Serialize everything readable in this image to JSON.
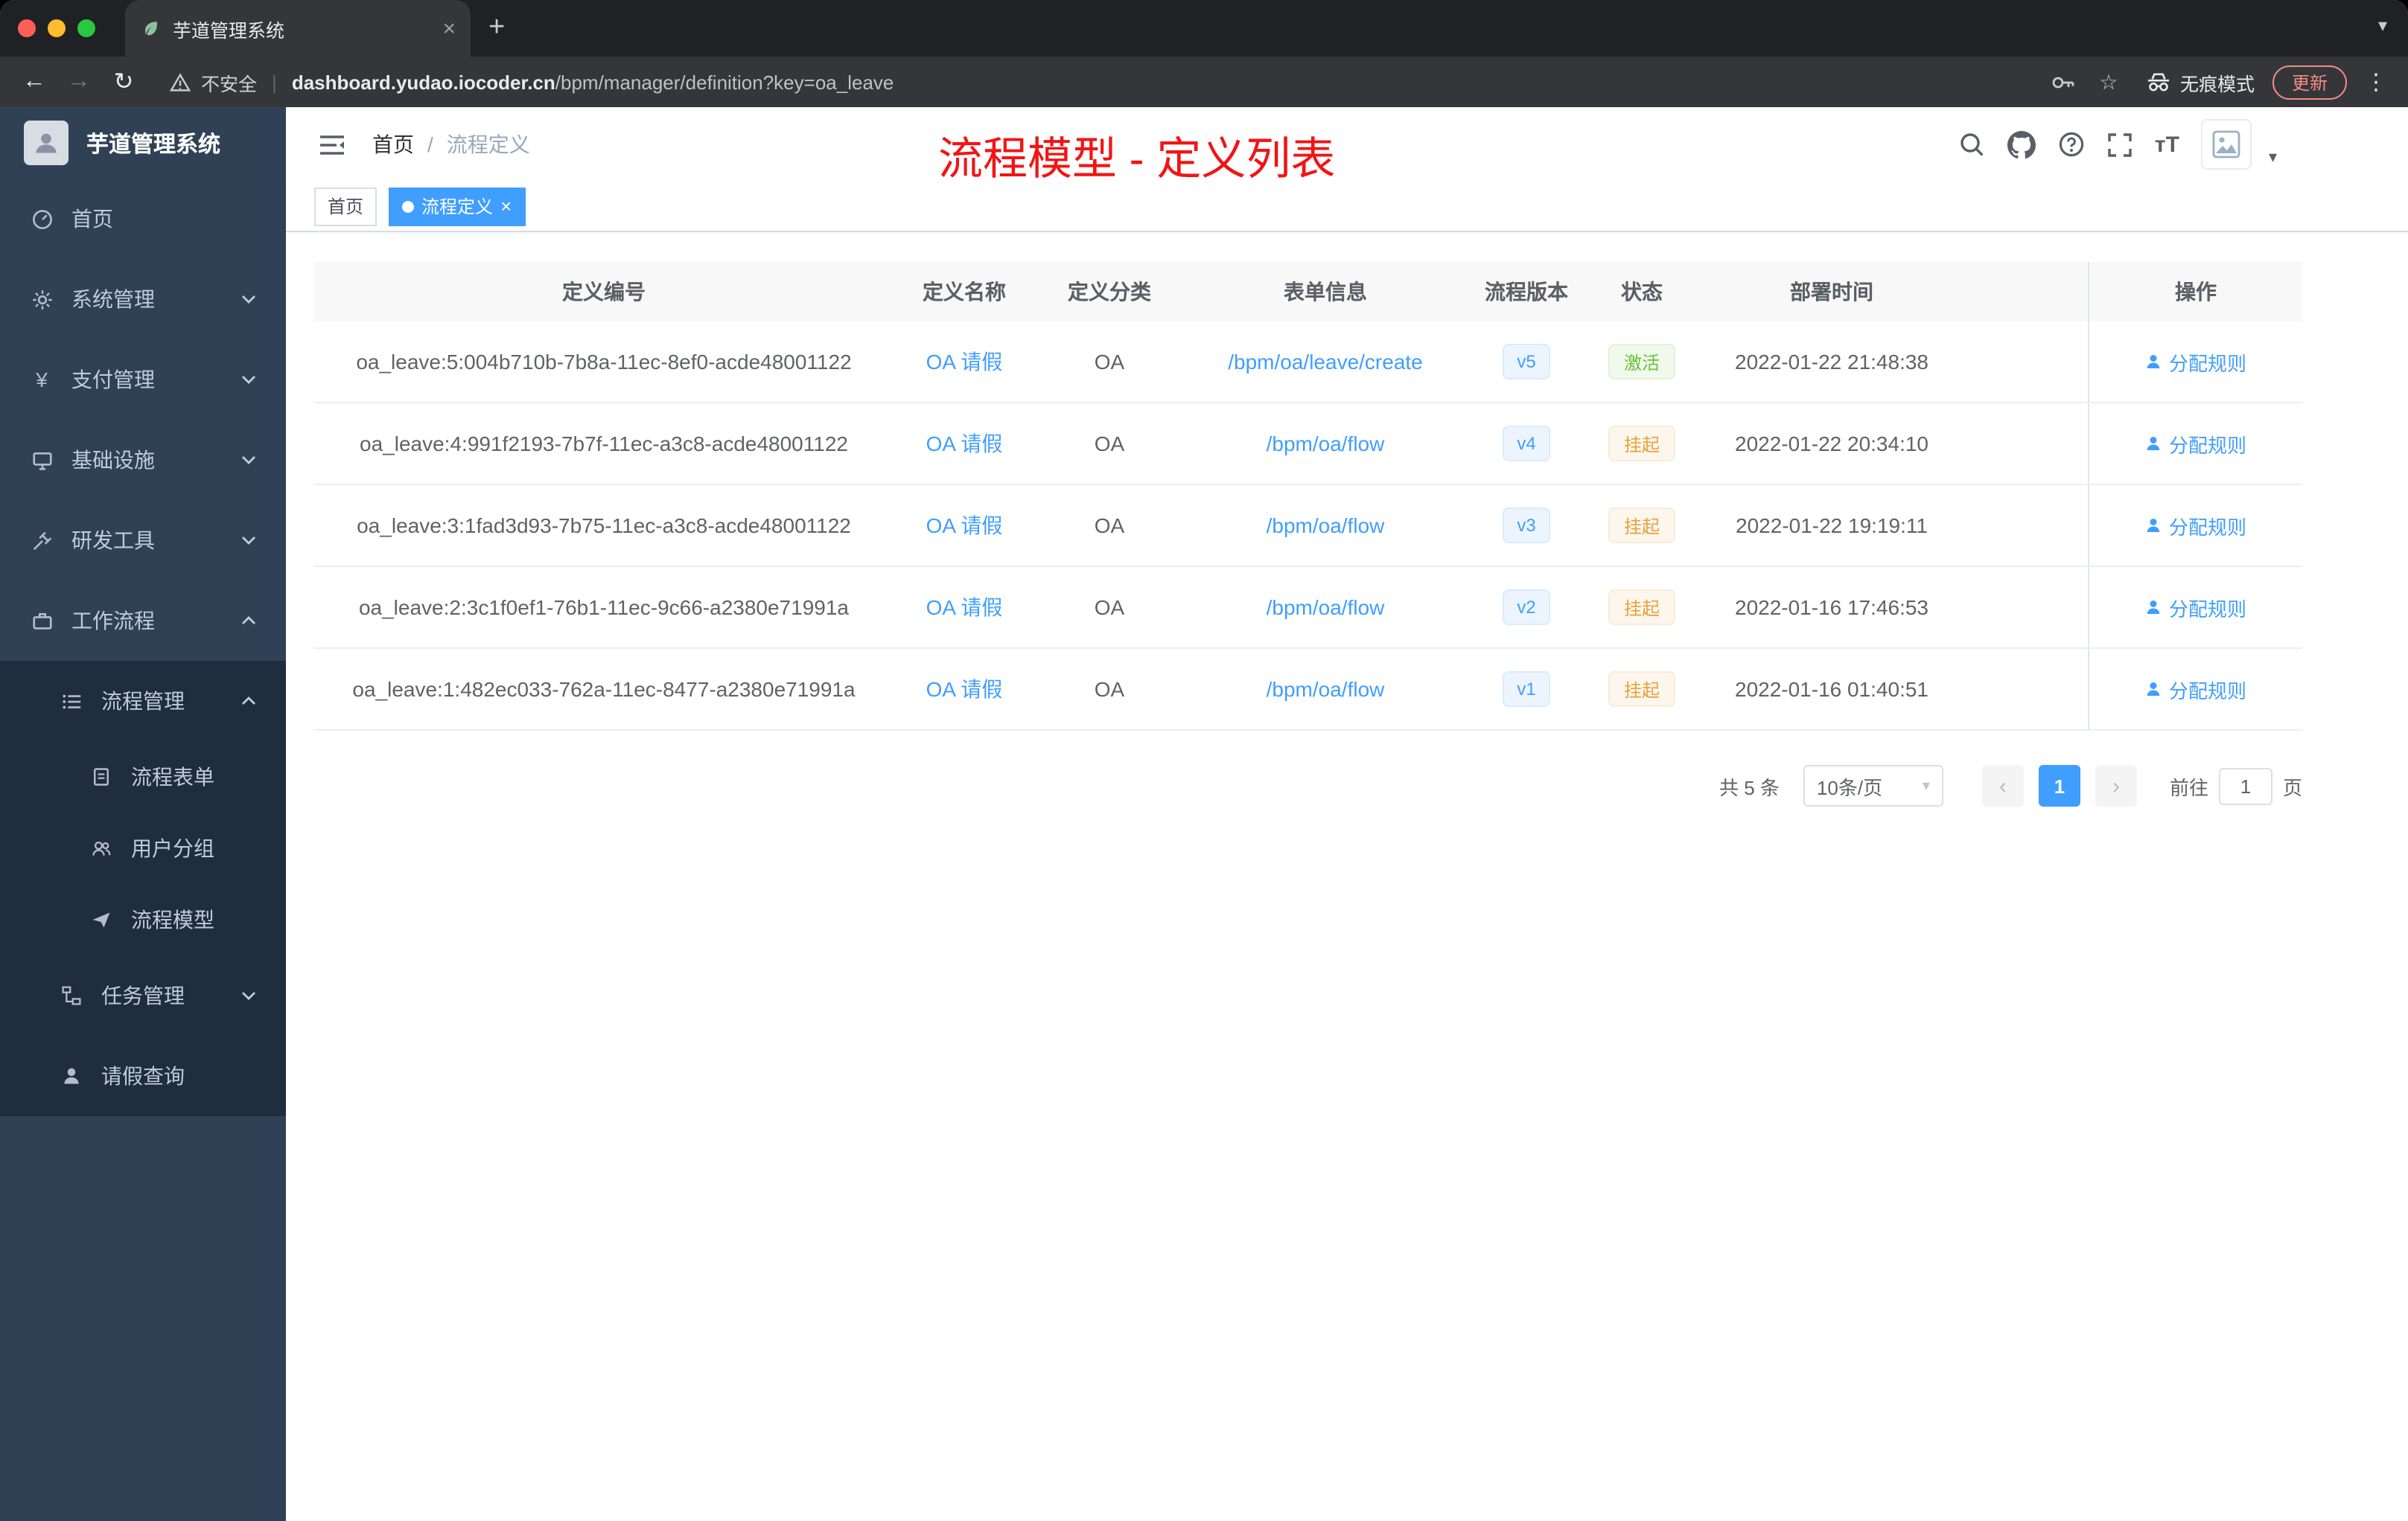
{
  "colors": {
    "accent": "#409eff",
    "success": "#67c23a",
    "warning": "#e6a23c",
    "annotation_red": "#f21414",
    "sidebar_bg": "#304156",
    "submenu_bg": "#1f2d3d"
  },
  "icons": {
    "tab_close": "×",
    "new_tab": "+",
    "caret_down": "▾",
    "back": "←",
    "forward": "→",
    "reload": "↻",
    "star": "☆",
    "more_dots": "⋮",
    "url_separator": "|",
    "breadcrumb_separator": "/",
    "prev": "‹",
    "next": "›",
    "font_size": "тT",
    "yen": "¥",
    "tag_close": "×"
  },
  "browser": {
    "tab_title": "芋道管理系统",
    "security_label": "不安全",
    "url_domain": "dashboard.yudao.iocoder.cn",
    "url_path": "/bpm/manager/definition?key=oa_leave",
    "incognito_label": "无痕模式",
    "update_label": "更新"
  },
  "sidebar": {
    "logo_title": "芋道管理系统",
    "items": [
      {
        "label": "首页"
      },
      {
        "label": "系统管理"
      },
      {
        "label": "支付管理"
      },
      {
        "label": "基础设施"
      },
      {
        "label": "研发工具"
      },
      {
        "label": "工作流程"
      },
      {
        "label": "流程管理"
      },
      {
        "label": "流程表单"
      },
      {
        "label": "用户分组"
      },
      {
        "label": "流程模型"
      },
      {
        "label": "任务管理"
      },
      {
        "label": "请假查询"
      }
    ]
  },
  "header": {
    "breadcrumb_home": "首页",
    "breadcrumb_current": "流程定义",
    "annotation": "流程模型 - 定义列表"
  },
  "tags": {
    "home": "首页",
    "active": "流程定义"
  },
  "table": {
    "columns": [
      "定义编号",
      "定义名称",
      "定义分类",
      "表单信息",
      "流程版本",
      "状态",
      "部署时间",
      "操作"
    ],
    "rows": [
      {
        "id": "oa_leave:5:004b710b-7b8a-11ec-8ef0-acde48001122",
        "name": "OA 请假",
        "category": "OA",
        "form": "/bpm/oa/leave/create",
        "version": "v5",
        "status": "激活",
        "time": "2022-01-22 21:48:38",
        "action": "分配规则"
      },
      {
        "id": "oa_leave:4:991f2193-7b7f-11ec-a3c8-acde48001122",
        "name": "OA 请假",
        "category": "OA",
        "form": "/bpm/oa/flow",
        "version": "v4",
        "status": "挂起",
        "time": "2022-01-22 20:34:10",
        "action": "分配规则"
      },
      {
        "id": "oa_leave:3:1fad3d93-7b75-11ec-a3c8-acde48001122",
        "name": "OA 请假",
        "category": "OA",
        "form": "/bpm/oa/flow",
        "version": "v3",
        "status": "挂起",
        "time": "2022-01-22 19:19:11",
        "action": "分配规则"
      },
      {
        "id": "oa_leave:2:3c1f0ef1-76b1-11ec-9c66-a2380e71991a",
        "name": "OA 请假",
        "category": "OA",
        "form": "/bpm/oa/flow",
        "version": "v2",
        "status": "挂起",
        "time": "2022-01-16 17:46:53",
        "action": "分配规则"
      },
      {
        "id": "oa_leave:1:482ec033-762a-11ec-8477-a2380e71991a",
        "name": "OA 请假",
        "category": "OA",
        "form": "/bpm/oa/flow",
        "version": "v1",
        "status": "挂起",
        "time": "2022-01-16 01:40:51",
        "action": "分配规则"
      }
    ]
  },
  "pagination": {
    "total": "共 5 条",
    "page_size": "10条/页",
    "current_page": "1",
    "goto_label": "前往",
    "goto_value": "1",
    "page_unit": "页"
  }
}
